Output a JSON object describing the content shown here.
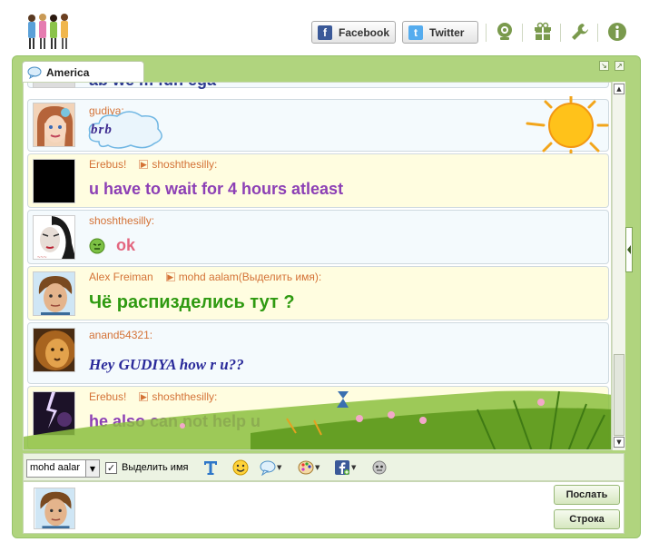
{
  "header": {
    "facebook_label": "Facebook",
    "twitter_label": "Twitter",
    "icons": [
      "webcam-icon",
      "gift-icon",
      "wrench-icon",
      "info-icon"
    ]
  },
  "room": {
    "tab_label": "America"
  },
  "messages": [
    {
      "author": "",
      "recipient": "",
      "text": "ab we m fun ega",
      "color": "#2c3a8f"
    },
    {
      "author": "gudiya:",
      "recipient": "",
      "text": "brb",
      "color": "#3d2a8f"
    },
    {
      "author": "Erebus!",
      "recipient": "shoshthesilly:",
      "text": "u have to wait for 4 hours atleast",
      "color": "#8c3fb5"
    },
    {
      "author": "shoshthesilly:",
      "recipient": "",
      "text": "ok",
      "color": "#e3667f"
    },
    {
      "author": "Alex Freiman",
      "recipient": "mohd aalam(Выделить имя):",
      "text": "Чё распизделись тут ?",
      "color": "#2f9a11"
    },
    {
      "author": "anand54321:",
      "recipient": "",
      "text": "Hey GUDIYA how r u??",
      "color": "#2a2a9a"
    },
    {
      "author": "Erebus!",
      "recipient": "shoshthesilly:",
      "text": "he also can not help u",
      "color": "#8c3fb5"
    }
  ],
  "toolbar": {
    "user_select_value": "mohd aalar",
    "highlight_checked": true,
    "highlight_label": "Выделить имя"
  },
  "buttons": {
    "send_label": "Послать",
    "line_label": "Строка"
  }
}
